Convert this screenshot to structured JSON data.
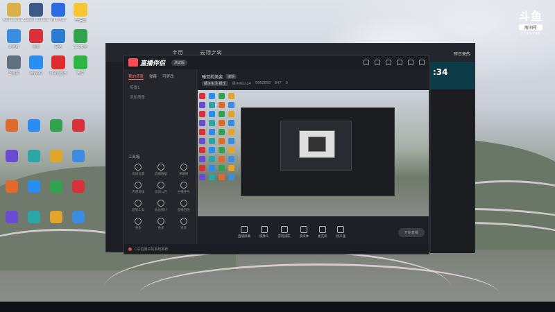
{
  "watermark": {
    "title": "斗鱼",
    "room_label": "房间号",
    "room_id": "7716768"
  },
  "desktop_icons": [
    {
      "label": "Administra...",
      "color": "#d9b04a"
    },
    {
      "label": "Steam Uninstaller",
      "color": "#3c5a86"
    },
    {
      "label": "WPS PDF",
      "color": "#2c6ce0"
    },
    {
      "label": "YY语音",
      "color": "#f7c531"
    },
    {
      "label": "此电脑",
      "color": "#3a8de0"
    },
    {
      "label": "迅雷",
      "color": "#d9313a"
    },
    {
      "label": "网络",
      "color": "#2a7bd1"
    },
    {
      "label": "360安全",
      "color": "#31a34f"
    },
    {
      "label": "回收站",
      "color": "#607080"
    },
    {
      "label": "腾讯QQ",
      "color": "#2a8df2"
    },
    {
      "label": "网易云音乐",
      "color": "#dd2e2e"
    },
    {
      "label": "微信",
      "color": "#2fb544"
    }
  ],
  "bg_window": {
    "tabs": [
      "主页",
      "云顶之弈"
    ],
    "right_value": ":34",
    "right_text": "昨日来的"
  },
  "app": {
    "name": "直播伴侣",
    "version": "测试版",
    "left_tabs": [
      "我的场景",
      "弹幕",
      "可更改"
    ],
    "scenes": [
      "场景1",
      "添加场景"
    ],
    "toolbox_title": "工具箱",
    "tools": [
      "房间设置",
      "直播数据",
      "弹幕姬",
      "内容审核",
      "房间公告",
      "主播任务",
      "超管工具",
      "收益统计",
      "直播回放",
      "更多",
      "更多",
      "更多"
    ],
    "room_title": "睡觉前美姿",
    "edit_label": "编辑",
    "room_category": "播主生活·娱乐",
    "room_meta": [
      "播主Wong4",
      "9962858",
      "847",
      "0"
    ],
    "controls": [
      "直播屏幕",
      "摄像头",
      "游戏捕获",
      "多媒体",
      "麦克风",
      "扬声器"
    ],
    "start_button": "开始直播",
    "status_text": "C杀直播中的系统推荐"
  },
  "colors": {
    "accent": "#ff4a5a"
  }
}
